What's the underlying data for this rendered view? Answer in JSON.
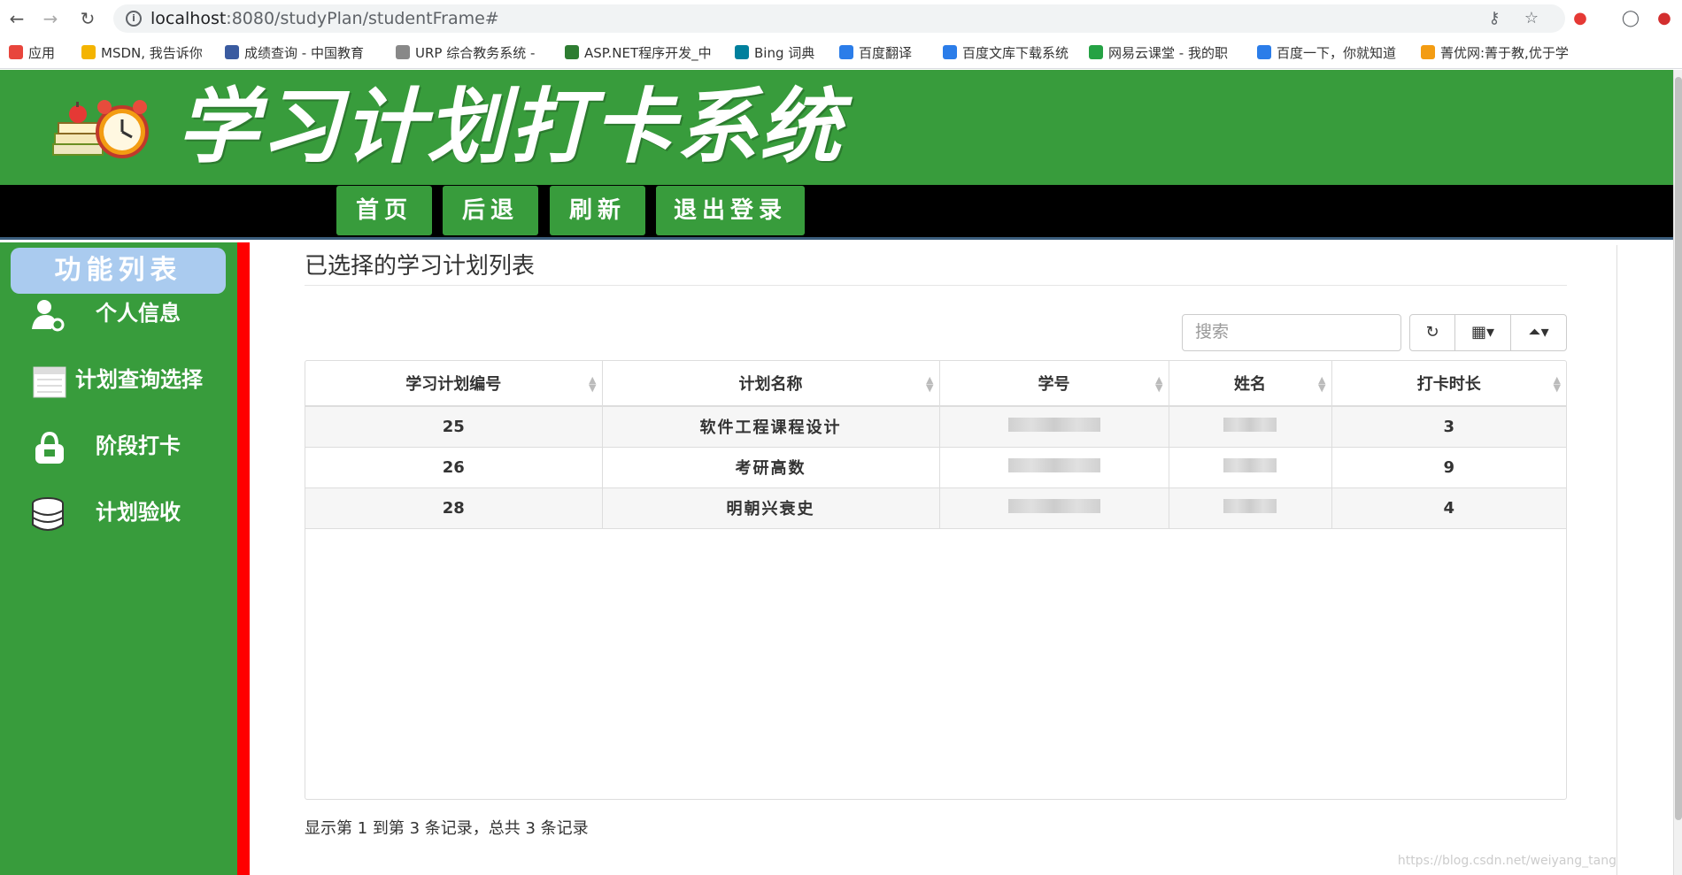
{
  "browser": {
    "url_host": "localhost",
    "url_path": ":8080/studyPlan/studentFrame#",
    "bookmarks": [
      {
        "label": "应用",
        "color": "#e8453c"
      },
      {
        "label": "MSDN, 我告诉你",
        "color": "#f4b400"
      },
      {
        "label": "成绩查询 - 中国教育",
        "color": "#3a5ba0"
      },
      {
        "label": "URP 综合教务系统 -",
        "color": "#888888"
      },
      {
        "label": "ASP.NET程序开发_中",
        "color": "#2e7d32"
      },
      {
        "label": "Bing 词典",
        "color": "#00809d"
      },
      {
        "label": "百度翻译",
        "color": "#2b7de9"
      },
      {
        "label": "百度文库下载系统",
        "color": "#2b7de9"
      },
      {
        "label": "网易云课堂 - 我的职",
        "color": "#25a244"
      },
      {
        "label": "百度一下，你就知道",
        "color": "#2b7de9"
      },
      {
        "label": "菁优网:菁于教,优于学",
        "color": "#f39c12"
      }
    ]
  },
  "header": {
    "title": "学习计划打卡系统",
    "nav": [
      "首页",
      "后退",
      "刷新",
      "退出登录"
    ]
  },
  "sidebar": {
    "title": "功能列表",
    "items": [
      "个人信息",
      "计划查询选择",
      "阶段打卡",
      "计划验收"
    ]
  },
  "main": {
    "title": "已选择的学习计划列表",
    "search_placeholder": "搜索",
    "columns": [
      "学习计划编号",
      "计划名称",
      "学号",
      "姓名",
      "打卡时长"
    ],
    "rows": [
      {
        "id": "25",
        "name": "软件工程课程设计",
        "hours": "3"
      },
      {
        "id": "26",
        "name": "考研高数",
        "hours": "9"
      },
      {
        "id": "28",
        "name": "明朝兴衰史",
        "hours": "4"
      }
    ],
    "pagination": "显示第 1 到第 3 条记录，总共 3 条记录"
  },
  "watermark": "https://blog.csdn.net/weiyang_tang"
}
